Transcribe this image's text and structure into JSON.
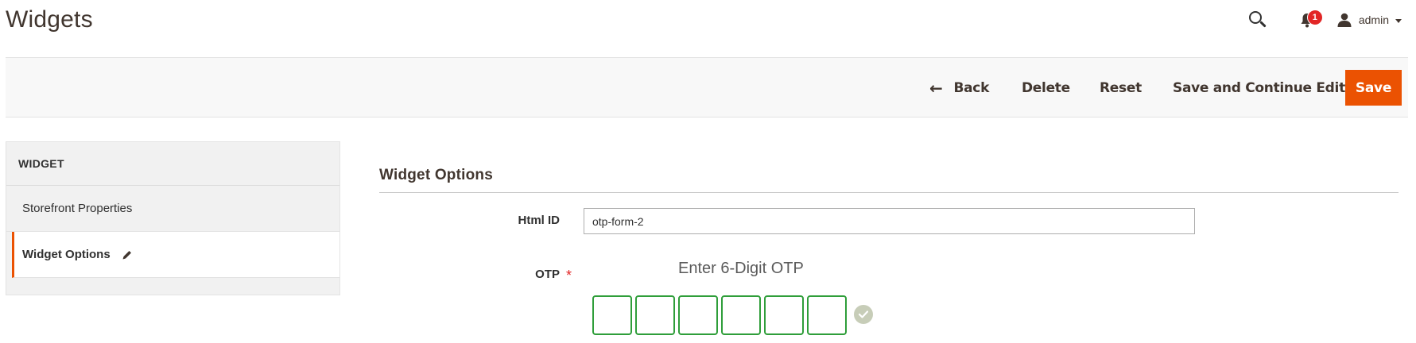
{
  "header": {
    "title": "Widgets",
    "notifications_count": "1",
    "user_name": "admin"
  },
  "actions": {
    "back": "Back",
    "delete": "Delete",
    "reset": "Reset",
    "save_continue": "Save and Continue Edit",
    "save": "Save"
  },
  "tabs": {
    "heading": "WIDGET",
    "items": [
      {
        "label": "Storefront Properties",
        "active": false
      },
      {
        "label": "Widget Options",
        "active": true
      }
    ]
  },
  "main": {
    "section_title": "Widget Options",
    "html_id_label": "Html ID",
    "html_id_value": "otp-form-2",
    "otp_label": "OTP",
    "otp_required": "*",
    "otp_heading": "Enter 6-Digit OTP",
    "otp_digits": [
      "",
      "",
      "",
      "",
      "",
      ""
    ]
  },
  "colors": {
    "accent": "#eb5202",
    "otp_border": "#2f9e3a",
    "badge": "#e22626"
  },
  "icons": [
    "search-icon",
    "bell-icon",
    "user-icon",
    "arrow-left-icon",
    "pencil-icon",
    "check-icon"
  ]
}
